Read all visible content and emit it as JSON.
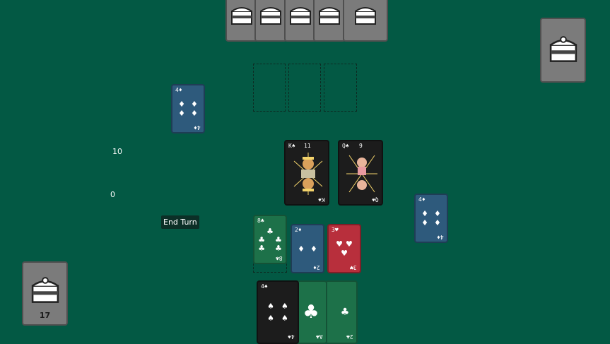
{
  "score_top": "10",
  "score_bottom": "0",
  "end_turn_label": "End Turn",
  "deck_count": "17",
  "cards": {
    "opponent_played": {
      "rank": "4",
      "suit": "♦",
      "pips": "♦"
    },
    "king": {
      "rank": "K",
      "suit": "♠",
      "value": "11"
    },
    "queen": {
      "rank": "Q",
      "suit": "♠",
      "value": "9"
    },
    "right_played": {
      "rank": "4",
      "suit": "♦",
      "pips": "♦"
    },
    "meld_green": {
      "rank": "8",
      "suit": "♣",
      "pips": "♣"
    },
    "meld_blue": {
      "rank": "2",
      "suit": "♦",
      "pips": "♦"
    },
    "meld_red": {
      "rank": "3",
      "suit": "♥",
      "pips": "♥"
    },
    "hand_black": {
      "rank": "4",
      "suit": "♠",
      "pips": "♠"
    },
    "hand_green_a": {
      "rank": "A",
      "suit": "♣",
      "pips": "♣"
    },
    "hand_green_b": {
      "rank": "2",
      "suit": "♣",
      "pips": "♣"
    }
  },
  "colors": {
    "table": "#035944",
    "blue": "#2e5a7c",
    "green": "#1d7149",
    "red": "#b82f3c",
    "black": "#1c1c1c",
    "card_back": "#7b7b7b"
  },
  "icons": [
    "cake-icon",
    "king-portrait-icon",
    "queen-portrait-icon"
  ]
}
